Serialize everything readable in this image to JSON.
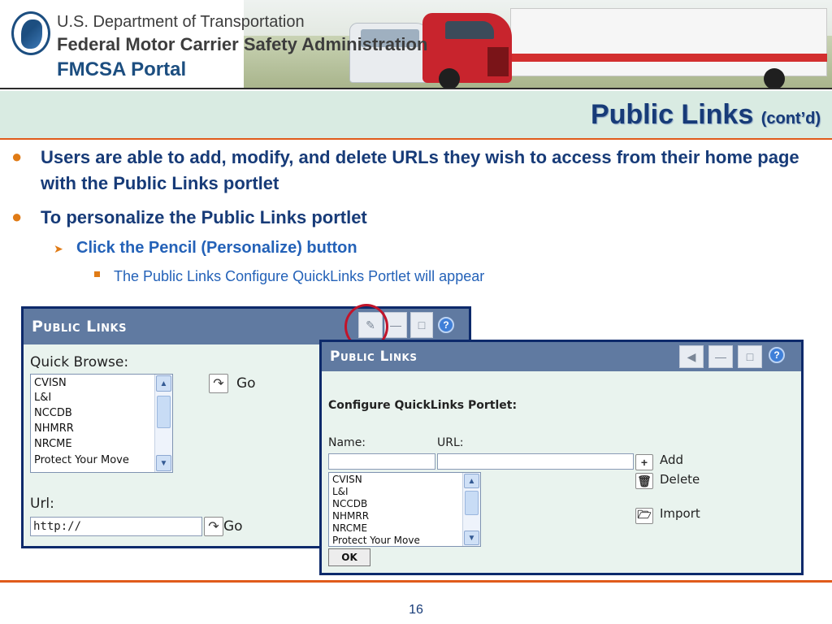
{
  "header": {
    "agency_line1": "U.S. Department of Transportation",
    "agency_line2": "Federal Motor Carrier Safety Administration",
    "portal_name": "FMCSA Portal"
  },
  "slide": {
    "title": "Public Links",
    "title_suffix": "(cont’d)",
    "page_number": "16"
  },
  "bullets": {
    "b1": "Users are able to add, modify, and delete URLs they wish to access from their home page with the Public Links portlet",
    "b2": "To personalize the Public Links portlet",
    "b3": "Click the Pencil (Personalize) button",
    "b4": "The Public Links Configure QuickLinks Portlet will appear"
  },
  "portlet_left": {
    "title": "Public Links",
    "quick_browse_label": "Quick Browse:",
    "items": [
      "CVISN",
      "L&I",
      "NCCDB",
      "NHMRR",
      "NRCME",
      "Protect Your Move"
    ],
    "go_label": "Go",
    "url_label": "Url:",
    "url_value": "http://",
    "url_go_label": "Go",
    "controls": [
      "pencil-icon",
      "minimize-icon",
      "maximize-icon",
      "help-icon"
    ]
  },
  "portlet_right": {
    "title": "Public Links",
    "heading": "Configure QuickLinks Portlet:",
    "name_label": "Name:",
    "url_label": "URL:",
    "items": [
      "CVISN",
      "L&I",
      "NCCDB",
      "NHMRR",
      "NRCME",
      "Protect Your Move"
    ],
    "add_label": "Add",
    "delete_label": "Delete",
    "import_label": "Import",
    "ok_label": "OK",
    "controls": [
      "back-icon",
      "minimize-icon",
      "maximize-icon",
      "help-icon"
    ]
  },
  "colors": {
    "title_blue": "#173b78",
    "accent_orange": "#e05b1b",
    "portlet_header": "#607aa1",
    "portlet_border": "#0d2a6b",
    "highlight_circle": "#c2142a"
  }
}
